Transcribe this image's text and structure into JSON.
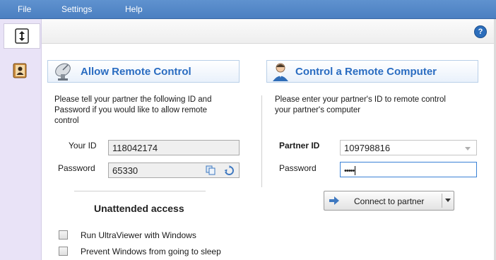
{
  "menu": {
    "file": "File",
    "settings": "Settings",
    "help": "Help"
  },
  "help_icon": "?",
  "allow": {
    "title": "Allow Remote Control",
    "description": [
      "Please tell your partner the following ID and",
      "Password if you would like to allow remote",
      "control"
    ],
    "your_id_label": "Your ID",
    "your_id_value": "118042174",
    "password_label": "Password",
    "password_value": "65330"
  },
  "control": {
    "title": "Control a Remote Computer",
    "description": [
      "Please enter your partner's ID to remote control",
      "your partner's computer"
    ],
    "partner_id_label": "Partner ID",
    "partner_id_value": "109798816",
    "password_label": "Password",
    "password_value": "•••••",
    "connect_label": "Connect to partner"
  },
  "unattended": {
    "title": "Unattended access",
    "options": [
      {
        "label": "Run UltraViewer with Windows",
        "checked": false
      },
      {
        "label": "Prevent Windows from going to sleep",
        "checked": false
      }
    ]
  },
  "colors": {
    "menubar": "#4b7fc1",
    "accent": "#2a6cc1",
    "sidebar": "#e9e3f7"
  }
}
